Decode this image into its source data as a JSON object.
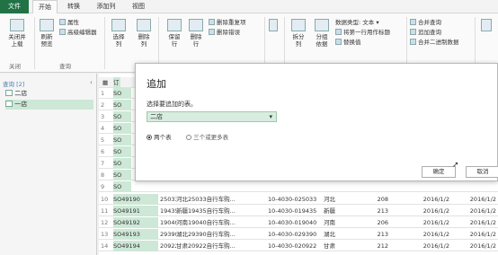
{
  "tabs": [
    "文件",
    "开始",
    "转换",
    "添加列",
    "视图"
  ],
  "ribbon": {
    "close_apply": "关闭并上载",
    "refresh": "刷新预览",
    "properties": "属性",
    "advanced_editor": "高级编辑器",
    "choose_cols": "选择列",
    "remove_cols": "删除列",
    "keep_rows": "保留行",
    "remove_rows": "删除行",
    "remove_dup": "删除重复项",
    "remove_err": "删除错误",
    "split": "拆分列",
    "group": "分组依据",
    "datatype": "数据类型: 文本",
    "first_row_header": "将第一行用作标题",
    "replace": "替换值",
    "merge_queries": "合并查询",
    "append_queries": "追加查询",
    "merge_binary": "合并二进制数据",
    "group_close": "关闭",
    "group_query": "查询"
  },
  "left": {
    "header": "查询 [2]",
    "items": [
      "二店",
      "一店"
    ]
  },
  "dialog": {
    "title": "追加",
    "prompt": "选择要追加的表。",
    "selected_table": "二店",
    "option1": "两个表",
    "option2": "三个或更多表",
    "ok": "确定",
    "cancel": "取消"
  },
  "rows": [
    {
      "n": "10",
      "a": "SO49190",
      "b": "25033",
      "c": "河北25033自行车购...",
      "d": "10-4030-025033",
      "e": "河北",
      "f": "208",
      "g": "2016/1/2",
      "h": "2016/1/2"
    },
    {
      "n": "11",
      "a": "SO49191",
      "b": "19435",
      "c": "新疆19435自行车购...",
      "d": "10-4030-019435",
      "e": "新疆",
      "f": "213",
      "g": "2016/1/2",
      "h": "2016/1/2"
    },
    {
      "n": "12",
      "a": "SO49192",
      "b": "19040",
      "c": "河南19040自行车购...",
      "d": "10-4030-019040",
      "e": "河南",
      "f": "206",
      "g": "2016/1/2",
      "h": "2016/1/2"
    },
    {
      "n": "13",
      "a": "SO49193",
      "b": "29390",
      "c": "湖北29390自行车购...",
      "d": "10-4030-029390",
      "e": "湖北",
      "f": "213",
      "g": "2016/1/2",
      "h": "2016/1/2"
    },
    {
      "n": "14",
      "a": "SO49194",
      "b": "20922",
      "c": "甘肃20922自行车购...",
      "d": "10-4030-020922",
      "e": "甘肃",
      "f": "212",
      "g": "2016/1/2",
      "h": "2016/1/2"
    }
  ],
  "hidden_rows": [
    "1",
    "2",
    "3",
    "4",
    "5",
    "6",
    "7",
    "8",
    "9"
  ],
  "hidden_so": "SO",
  "col_header": "订",
  "colors": {
    "accent": "#217346",
    "selected": "#cde8d6"
  }
}
